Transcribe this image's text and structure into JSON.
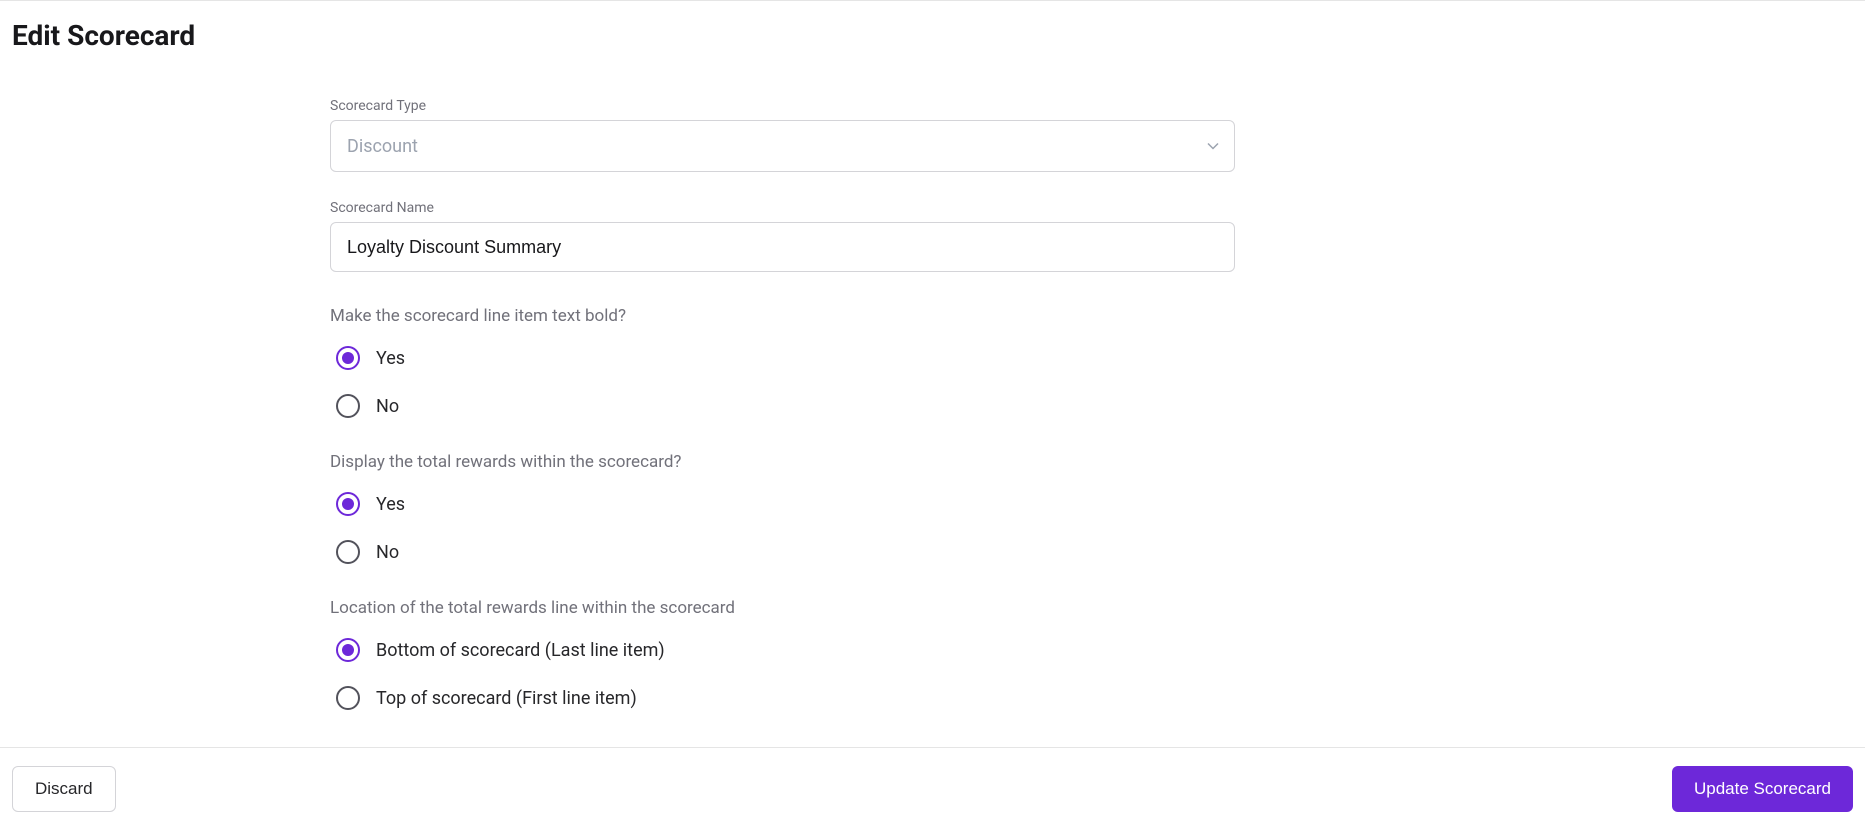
{
  "header": {
    "title": "Edit Scorecard"
  },
  "form": {
    "type_label": "Scorecard Type",
    "type_value": "Discount",
    "name_label": "Scorecard Name",
    "name_value": "Loyalty Discount Summary",
    "q_bold": {
      "text": "Make the scorecard line item text bold?",
      "options": {
        "yes": "Yes",
        "no": "No"
      },
      "selected": "yes"
    },
    "q_display_total": {
      "text": "Display the total rewards within the scorecard?",
      "options": {
        "yes": "Yes",
        "no": "No"
      },
      "selected": "yes"
    },
    "q_location": {
      "text": "Location of the total rewards line within the scorecard",
      "options": {
        "bottom": "Bottom of scorecard (Last line item)",
        "top": "Top of scorecard (First line item)"
      },
      "selected": "bottom"
    }
  },
  "footer": {
    "discard": "Discard",
    "update": "Update Scorecard"
  }
}
